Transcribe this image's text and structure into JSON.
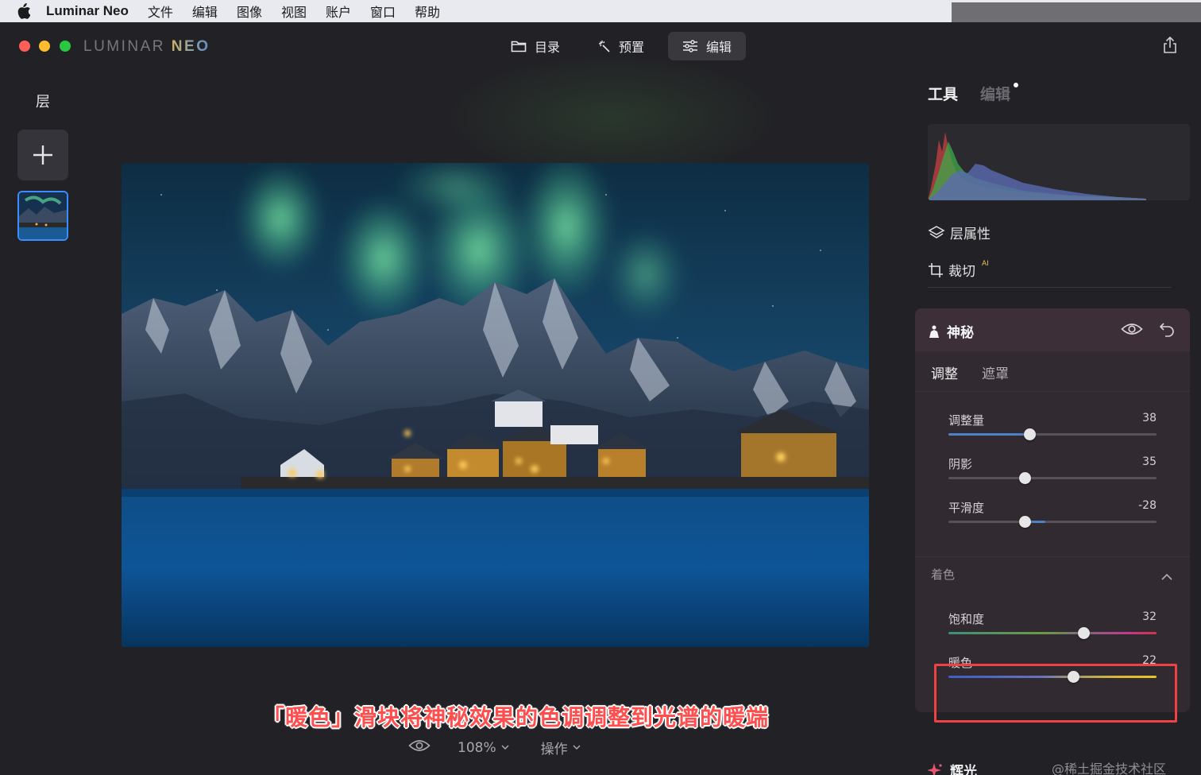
{
  "menubar": {
    "app_name": "Luminar Neo",
    "items": [
      "文件",
      "编辑",
      "图像",
      "视图",
      "账户",
      "窗口",
      "帮助"
    ]
  },
  "window": {
    "logo_left": "LUMINAR",
    "logo_right": "NEO",
    "nav": {
      "catalog": "目录",
      "presets": "预置",
      "edit": "编辑",
      "active": "edit"
    }
  },
  "layers": {
    "title": "层"
  },
  "right_panel": {
    "tab_tools": "工具",
    "tab_edits": "编辑",
    "tools": {
      "layer_properties": "层属性",
      "crop": "裁切",
      "crop_badge": "AI"
    },
    "mystical": {
      "title": "神秘",
      "subtab_adjust": "调整",
      "subtab_mask": "遮罩",
      "sliders": [
        {
          "label": "调整量",
          "value": "38",
          "fraction": 0.39
        },
        {
          "label": "阴影",
          "value": "35",
          "fraction": 0.37
        },
        {
          "label": "平滑度",
          "value": "-28",
          "fraction": 0.37
        }
      ],
      "toning_title": "着色",
      "toning_sliders": [
        {
          "label": "饱和度",
          "value": "32",
          "fraction": 0.65
        },
        {
          "label": "暖色",
          "value": "22",
          "fraction": 0.6
        }
      ]
    },
    "glow_title": "辉光"
  },
  "bottombar": {
    "zoom": "108%",
    "actions": "操作"
  },
  "caption": "「暖色」滑块将神秘效果的色调调整到光谱的暖端",
  "watermark": "@稀土掘金技术社区",
  "colors": {
    "accent_blue": "#3b8cff",
    "highlight_red": "#ef4242",
    "caption_red": "#ff4e4e"
  }
}
